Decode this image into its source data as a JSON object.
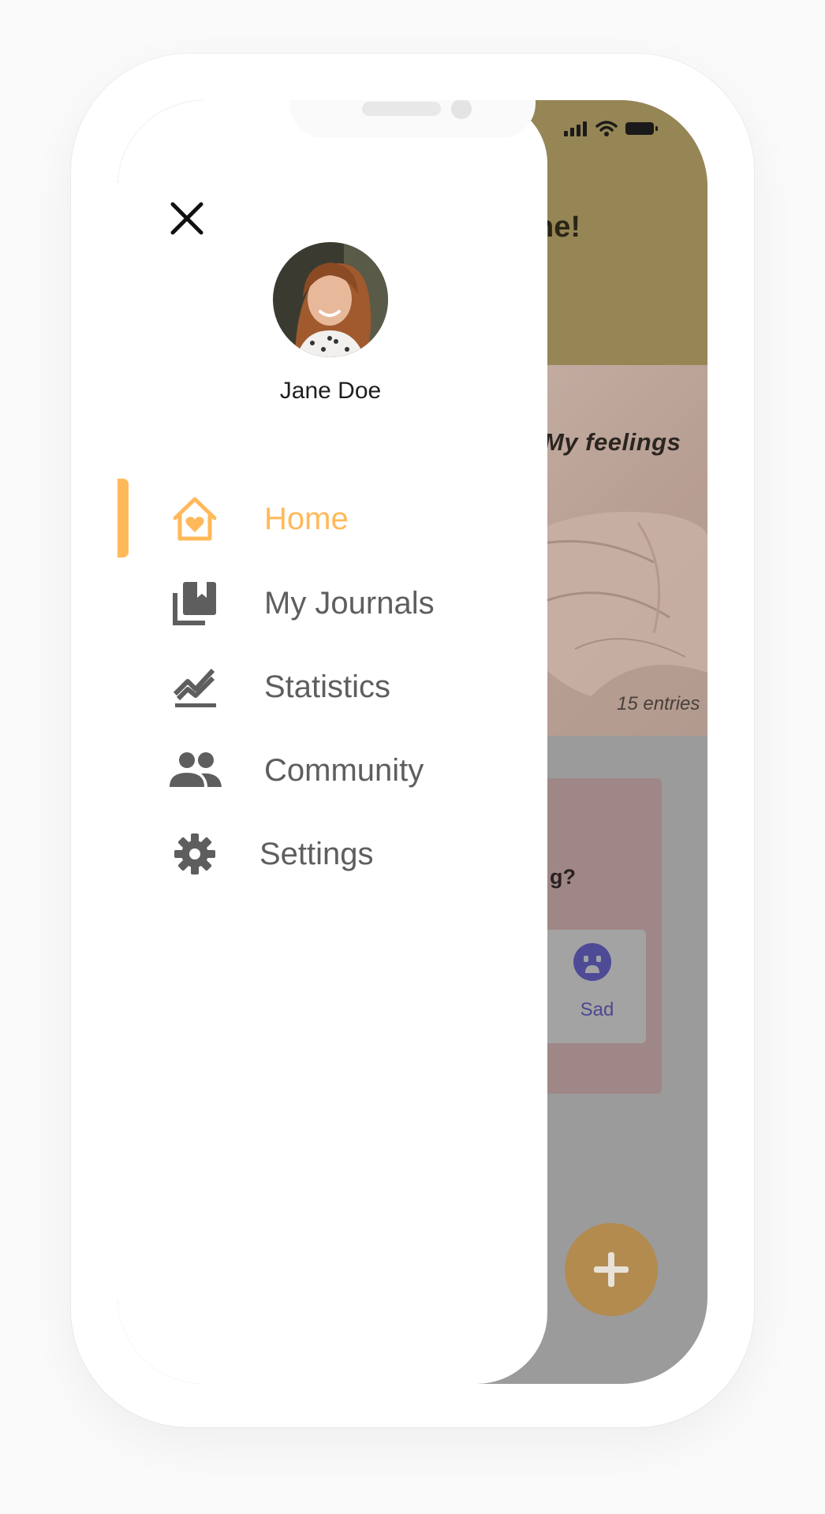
{
  "background": {
    "greeting_fragment": "ne!",
    "card_title_fragment": "My feelings",
    "card_entries": "15 entries",
    "mood_question_fragment": "g?",
    "mood_option_label": "Sad"
  },
  "drawer": {
    "user_name": "Jane Doe",
    "nav": [
      {
        "label": "Home",
        "icon": "home-heart-icon",
        "active": true
      },
      {
        "label": "My Journals",
        "icon": "journals-icon",
        "active": false
      },
      {
        "label": "Statistics",
        "icon": "statistics-icon",
        "active": false
      },
      {
        "label": "Community",
        "icon": "community-icon",
        "active": false
      },
      {
        "label": "Settings",
        "icon": "gear-icon",
        "active": false
      }
    ]
  },
  "colors": {
    "accent": "#ffb95a",
    "nav_text": "#5e5e5e",
    "header_dimmed": "#968656",
    "fab_dimmed": "#b38b4f"
  }
}
